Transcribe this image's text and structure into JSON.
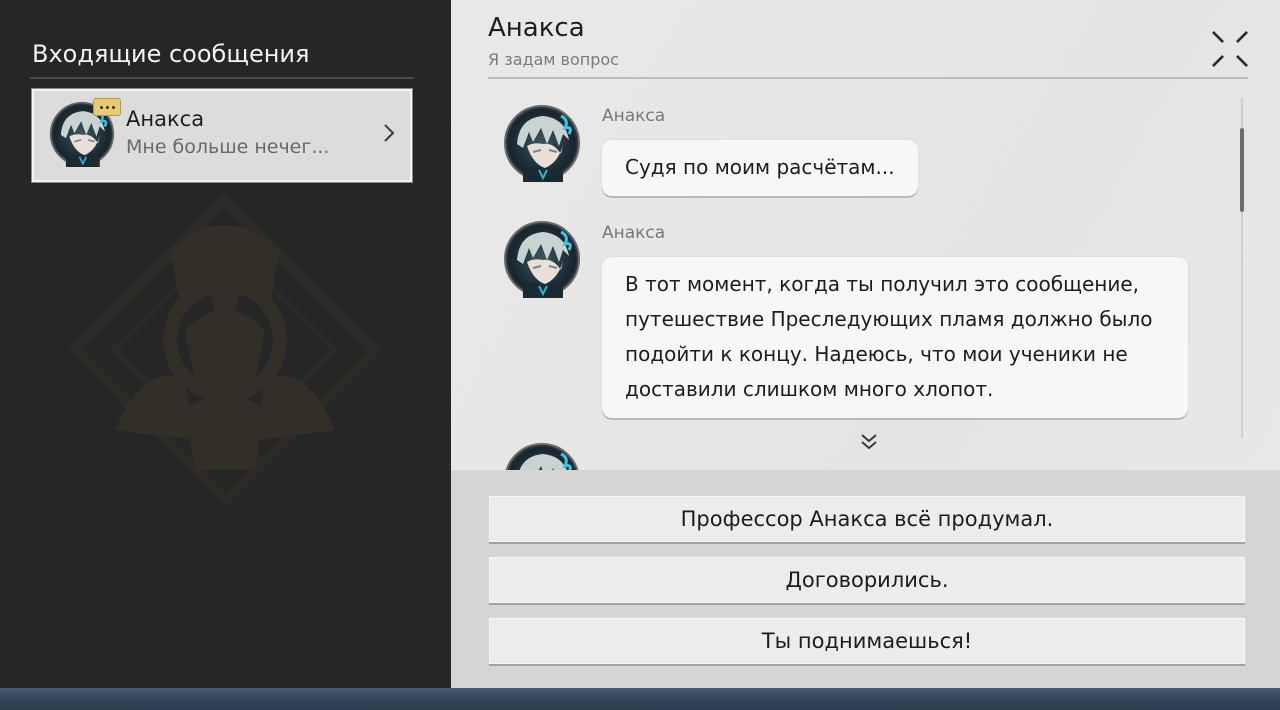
{
  "inbox": {
    "title": "Входящие сообщения",
    "contacts": [
      {
        "name": "Анакса",
        "preview": "Мне больше нечег...",
        "unread_icon": "ellipsis-badge-icon"
      }
    ]
  },
  "chat": {
    "title": "Анакса",
    "subtitle": "Я задам вопрос",
    "messages": [
      {
        "sender": "Анакса",
        "text": "Судя по моим расчётам..."
      },
      {
        "sender": "Анакса",
        "text_lines": [
          "В тот момент, когда ты получил это сообщение,",
          "путешествие Преследующих пламя должно было",
          "подойти к концу. Надеюсь, что мои ученики не",
          "доставили слишком много хлопот."
        ]
      }
    ]
  },
  "options": [
    {
      "label": "Профессор Анакса всё продумал."
    },
    {
      "label": "Договорились."
    },
    {
      "label": "Ты поднимаешься!"
    }
  ],
  "icons": {
    "close": "close-x-icon",
    "expand": "chevron-right-icon",
    "scroll_more": "double-chevron-down-icon"
  },
  "colors": {
    "left_bg": "#262626",
    "right_bg": "#e6e6e7",
    "badge": "#e8c977",
    "bubble": "#f7f7f7"
  }
}
